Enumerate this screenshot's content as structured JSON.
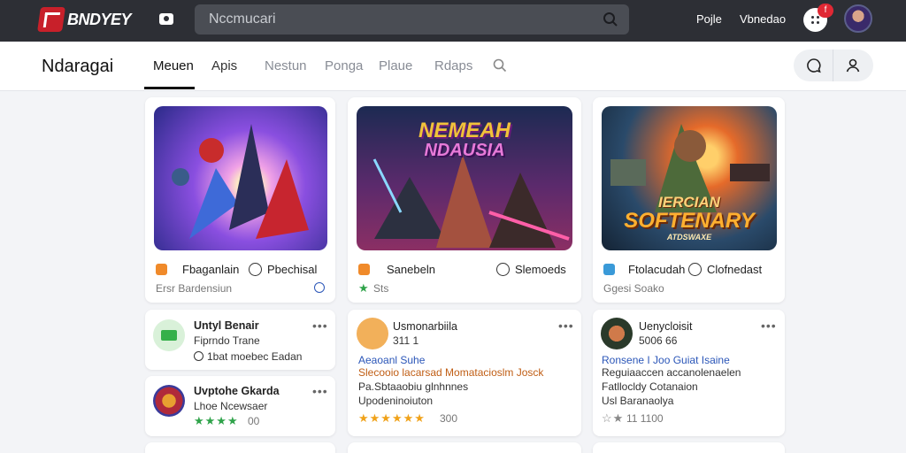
{
  "topbar": {
    "logo_text": "BNDYEY",
    "search_placeholder": "Nccmucari",
    "links": [
      "Pojle",
      "Vbnedao"
    ],
    "badge": "f"
  },
  "navbar": {
    "brand": "Ndaragai",
    "tabs": [
      "Meuen",
      "Apis",
      "Nestun",
      "Ponga",
      "Plaue",
      "Rdaps"
    ]
  },
  "cards": [
    {
      "hero_title": "",
      "left_label": "Fbaganlain",
      "right_label": "Pbechisal",
      "sub": "Ersr Bardensiun"
    },
    {
      "hero_title_1": "NEMEAH",
      "hero_title_2": "NDAUSIA",
      "left_label": "Sanebeln",
      "right_label": "Slemoeds",
      "sub": "Sts"
    },
    {
      "hero_title_1": "IERCIAN",
      "hero_title_2": "SOFTENARY",
      "hero_title_3": "ATDSWAXE",
      "left_label": "Ftolacudah",
      "right_label": "Clofnedast",
      "sub": "Ggesi Soako"
    }
  ],
  "list_items": [
    {
      "title": "Untyl Benair",
      "line1": "Fiprndo Trane",
      "line2": "1bat moebec Eadan"
    },
    {
      "title": "Uvptohe Gkarda",
      "line1": "Lhoe Ncewsaer",
      "line2": "00"
    },
    {
      "title": "Usmonarbiila",
      "line1": "311 1",
      "blue": "Aeaoanl Suhe",
      "orange": "Slecooio lacarsad Momatacioslm Josck",
      "line3": "Pa.Sbtaaobiu glnhnnes",
      "line4": "Upodeninoiuton",
      "count": "300"
    },
    {
      "title": "Uenycloisit",
      "line1": "5006 66",
      "blue": "Ronsene I Joo Guiat Isaine",
      "orange": "Reguiaaccen accanolenaelen",
      "line3": "Fatllocldy Cotanaion",
      "line4": "Usl Baranaolya",
      "count": "11 1100"
    }
  ],
  "colors": {
    "topbar": "#2d2f35",
    "accent_red": "#c8202a",
    "link_blue": "#2b56b8",
    "highlight_orange": "#c05e15",
    "star": "#f0a21a"
  }
}
